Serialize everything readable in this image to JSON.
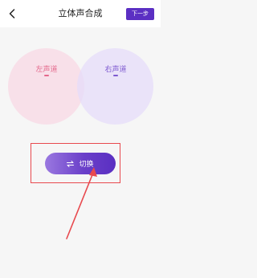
{
  "header": {
    "title": "立体声合成",
    "next_label": "下一步",
    "back_icon": "chevron-left-icon"
  },
  "channels": {
    "left": {
      "label": "左声道",
      "value": "-",
      "color": "#e4688c"
    },
    "right": {
      "label": "右声道",
      "value": "-",
      "color": "#7d59d0"
    }
  },
  "switch": {
    "label": "切换",
    "icon": "swap-icon"
  },
  "colors": {
    "accent": "#5b2fc3",
    "annotation": "#e8494e"
  }
}
